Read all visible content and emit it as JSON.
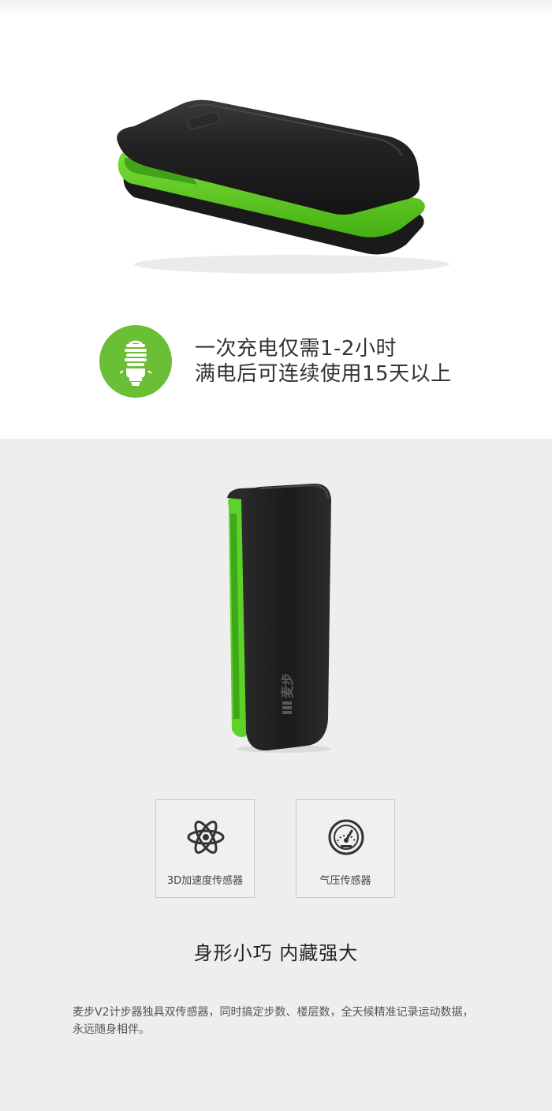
{
  "battery": {
    "line1": "一次充电仅需1-2小时",
    "line2": "满电后可连续使用15天以上",
    "icon": "bulb-icon",
    "icon_bg": "#6abf36"
  },
  "device": {
    "brand": "麦步",
    "accent": "#5ed12a",
    "body": "#1e1e1e"
  },
  "features": [
    {
      "label": "3D加速度传感器",
      "icon": "atom-icon"
    },
    {
      "label": "气压传感器",
      "icon": "gauge-icon"
    }
  ],
  "headline": "身形小巧 内藏强大",
  "description": "麦步V2计步器独具双传感器，同时搞定步数、楼层数，全天候精准记录运动数据，永远随身相伴。"
}
